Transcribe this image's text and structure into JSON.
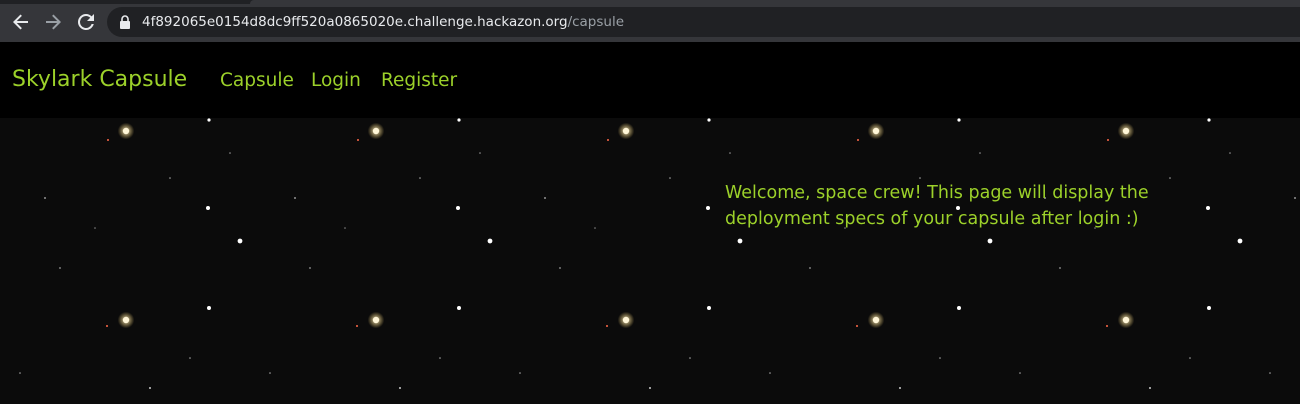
{
  "browser": {
    "url_host": "4f892065e0154d8dc9ff520a0865020e.challenge.hackazon.org",
    "url_path": "/capsule",
    "back_icon": "arrow-left-icon",
    "forward_icon": "arrow-right-icon",
    "reload_icon": "reload-icon",
    "lock_icon": "lock-icon"
  },
  "navbar": {
    "brand": "Skylark Capsule",
    "links": [
      {
        "label": "Capsule"
      },
      {
        "label": "Login"
      },
      {
        "label": "Register"
      }
    ]
  },
  "hero": {
    "welcome_text": "Welcome, space crew! This page will display the deployment specs of your capsule after login :)"
  },
  "colors": {
    "accent": "#9cd12a",
    "background": "#000000",
    "browser_bar": "#35363a",
    "url_field": "#202124"
  }
}
